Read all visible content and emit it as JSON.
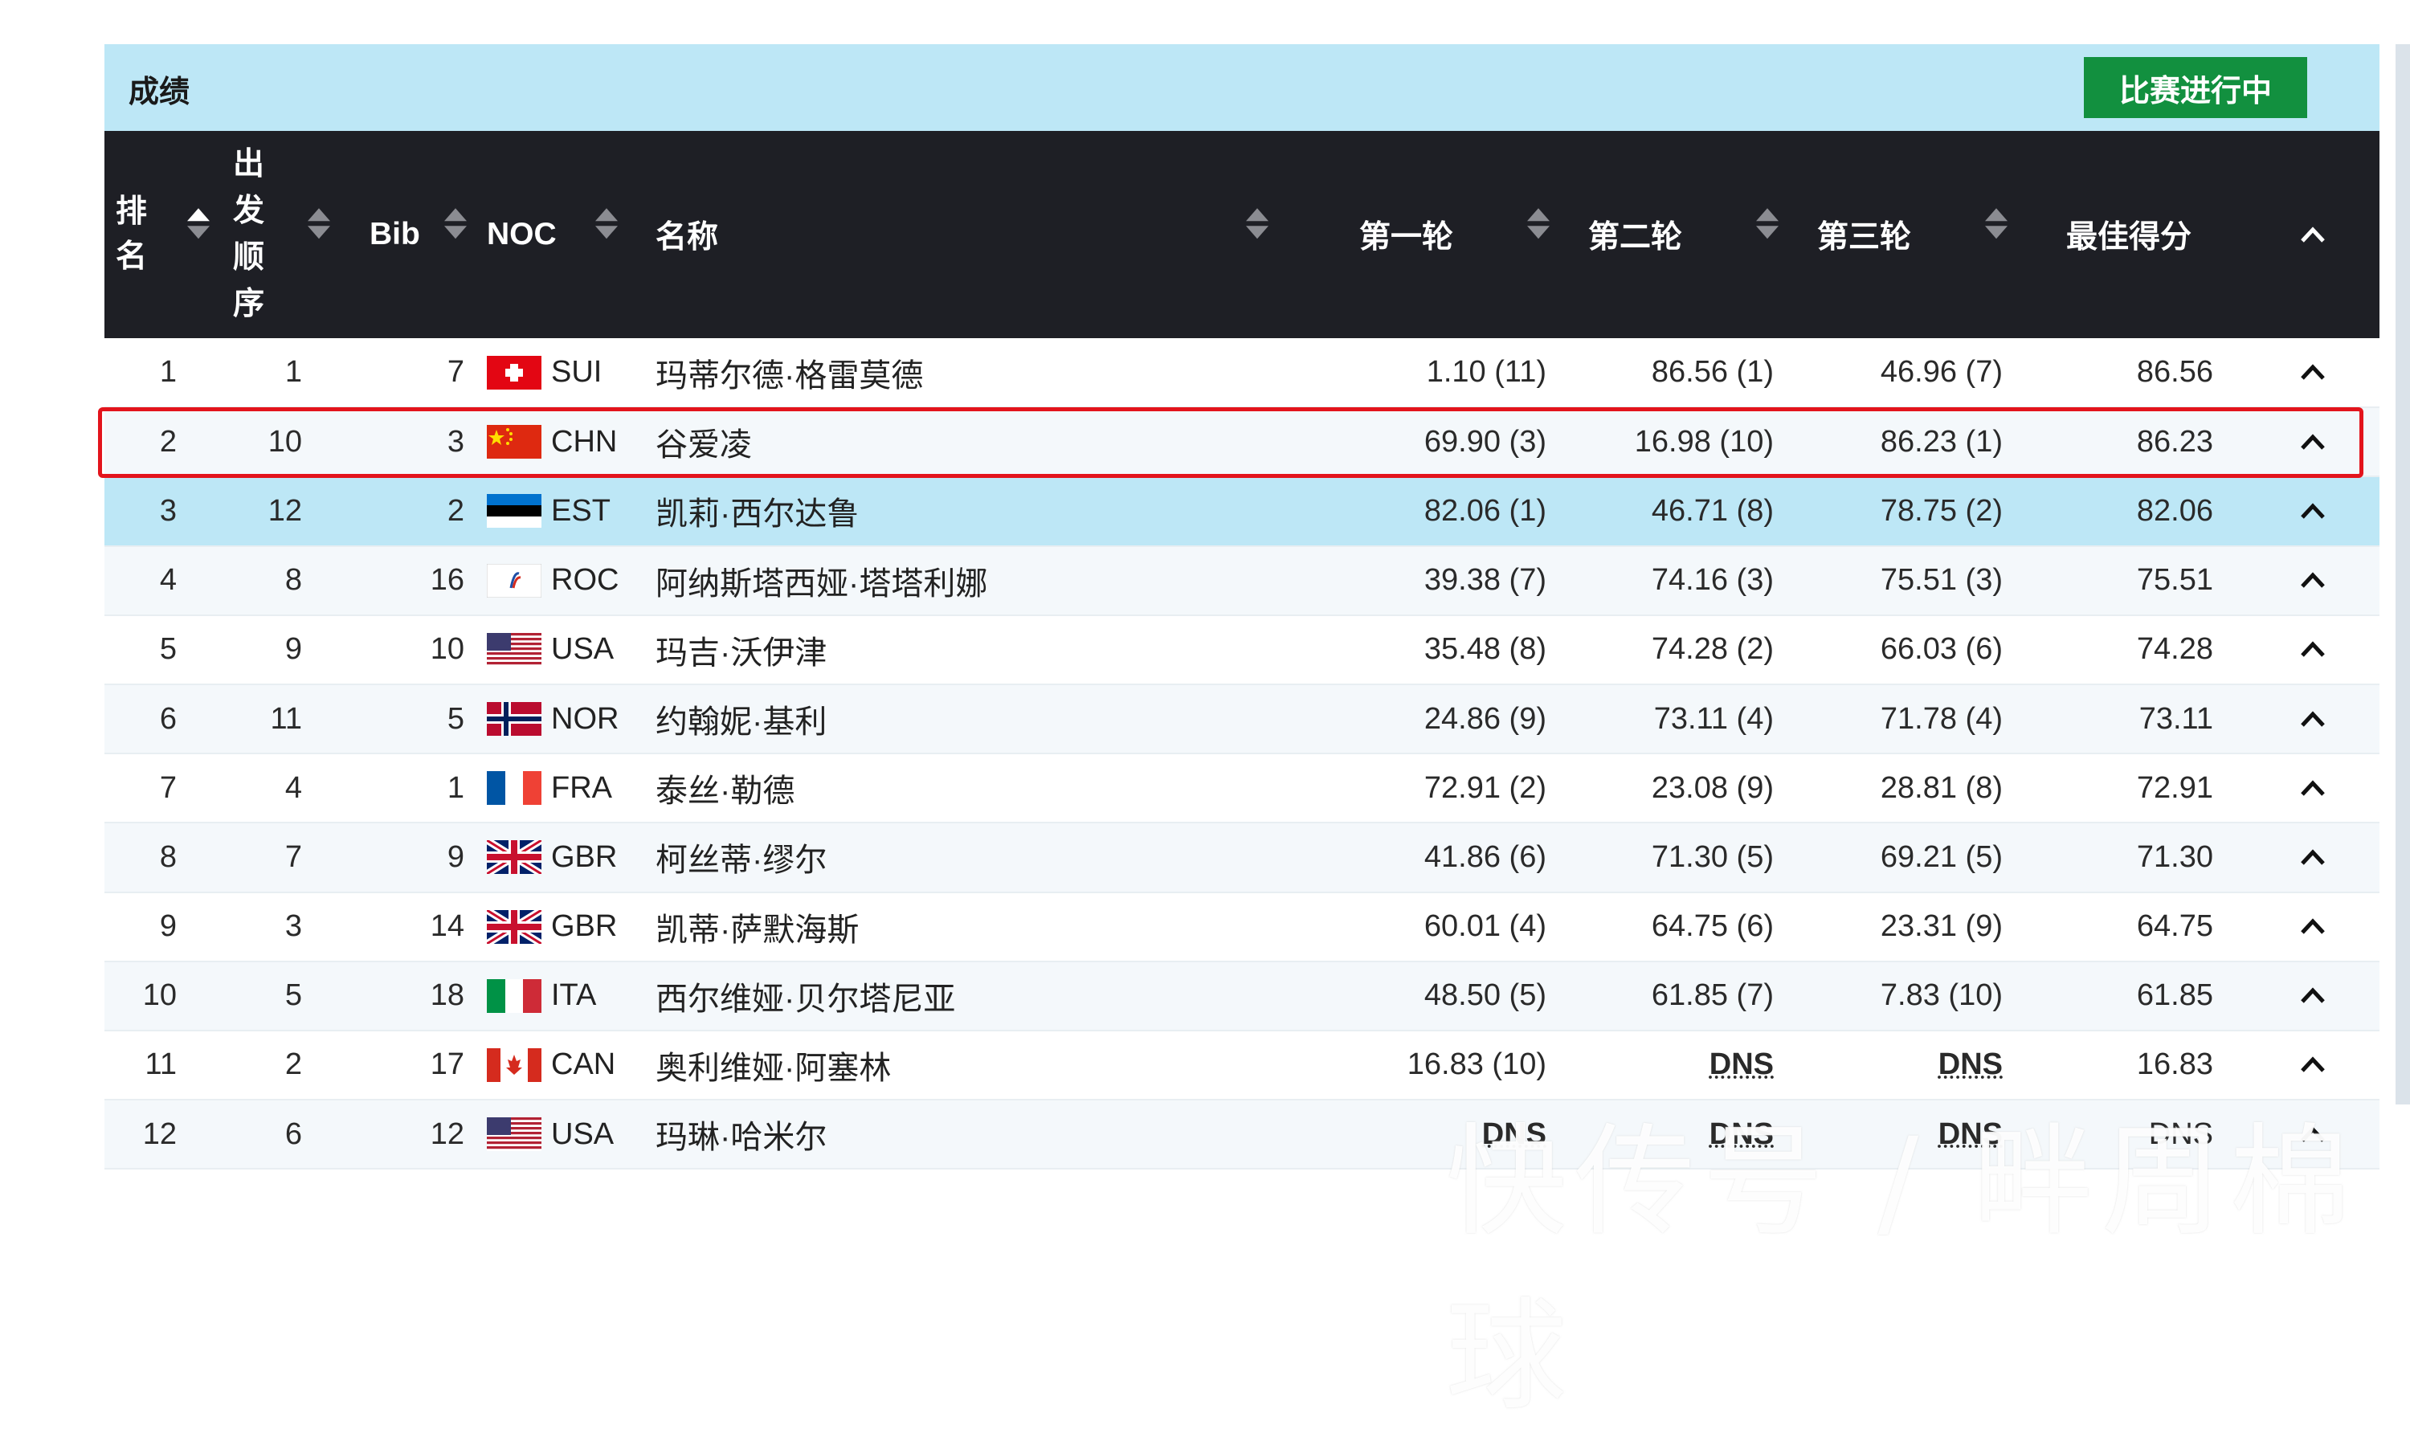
{
  "panel": {
    "title": "成绩",
    "status_badge": "比赛进行中"
  },
  "columns": {
    "rank": "排名",
    "start_order": "出发顺序",
    "bib": "Bib",
    "noc": "NOC",
    "name": "名称",
    "run1": "第一轮",
    "run2": "第二轮",
    "run3": "第三轮",
    "best": "最佳得分"
  },
  "rows": [
    {
      "rank": "1",
      "order": "1",
      "bib": "7",
      "noc": "SUI",
      "flag": "sui",
      "name": "玛蒂尔德·格雷莫德",
      "run1": "1.10 (11)",
      "run2": "86.56 (1)",
      "run3": "46.96 (7)",
      "best": "86.56"
    },
    {
      "rank": "2",
      "order": "10",
      "bib": "3",
      "noc": "CHN",
      "flag": "chn",
      "name": "谷爱凌",
      "run1": "69.90 (3)",
      "run2": "16.98 (10)",
      "run3": "86.23 (1)",
      "best": "86.23"
    },
    {
      "rank": "3",
      "order": "12",
      "bib": "2",
      "noc": "EST",
      "flag": "est",
      "name": "凯莉·西尔达鲁",
      "run1": "82.06 (1)",
      "run2": "46.71 (8)",
      "run3": "78.75 (2)",
      "best": "82.06"
    },
    {
      "rank": "4",
      "order": "8",
      "bib": "16",
      "noc": "ROC",
      "flag": "roc",
      "name": "阿纳斯塔西娅·塔塔利娜",
      "run1": "39.38 (7)",
      "run2": "74.16 (3)",
      "run3": "75.51 (3)",
      "best": "75.51"
    },
    {
      "rank": "5",
      "order": "9",
      "bib": "10",
      "noc": "USA",
      "flag": "usa",
      "name": "玛吉·沃伊津",
      "run1": "35.48 (8)",
      "run2": "74.28 (2)",
      "run3": "66.03 (6)",
      "best": "74.28"
    },
    {
      "rank": "6",
      "order": "11",
      "bib": "5",
      "noc": "NOR",
      "flag": "nor",
      "name": "约翰妮·基利",
      "run1": "24.86 (9)",
      "run2": "73.11 (4)",
      "run3": "71.78 (4)",
      "best": "73.11"
    },
    {
      "rank": "7",
      "order": "4",
      "bib": "1",
      "noc": "FRA",
      "flag": "fra",
      "name": "泰丝·勒德",
      "run1": "72.91 (2)",
      "run2": "23.08 (9)",
      "run3": "28.81 (8)",
      "best": "72.91"
    },
    {
      "rank": "8",
      "order": "7",
      "bib": "9",
      "noc": "GBR",
      "flag": "gbr",
      "name": "柯丝蒂·缪尔",
      "run1": "41.86 (6)",
      "run2": "71.30 (5)",
      "run3": "69.21 (5)",
      "best": "71.30"
    },
    {
      "rank": "9",
      "order": "3",
      "bib": "14",
      "noc": "GBR",
      "flag": "gbr",
      "name": "凯蒂·萨默海斯",
      "run1": "60.01 (4)",
      "run2": "64.75 (6)",
      "run3": "23.31 (9)",
      "best": "64.75"
    },
    {
      "rank": "10",
      "order": "5",
      "bib": "18",
      "noc": "ITA",
      "flag": "ita",
      "name": "西尔维娅·贝尔塔尼亚",
      "run1": "48.50 (5)",
      "run2": "61.85 (7)",
      "run3": "7.83 (10)",
      "best": "61.85"
    },
    {
      "rank": "11",
      "order": "2",
      "bib": "17",
      "noc": "CAN",
      "flag": "can",
      "name": "奥利维娅·阿塞林",
      "run1": "16.83 (10)",
      "run2": "DNS",
      "run3": "DNS",
      "best": "16.83"
    },
    {
      "rank": "12",
      "order": "6",
      "bib": "12",
      "noc": "USA",
      "flag": "usa",
      "name": "玛琳·哈米尔",
      "run1": "DNS",
      "run2": "DNS",
      "run3": "DNS",
      "best": "DNS"
    }
  ],
  "watermark": "快传号 / 畔周棉球",
  "colors": {
    "header_bg": "#1e1f25",
    "title_bg": "#bde7f6",
    "badge_bg": "#12903f",
    "highlight_border": "#e3141c"
  }
}
